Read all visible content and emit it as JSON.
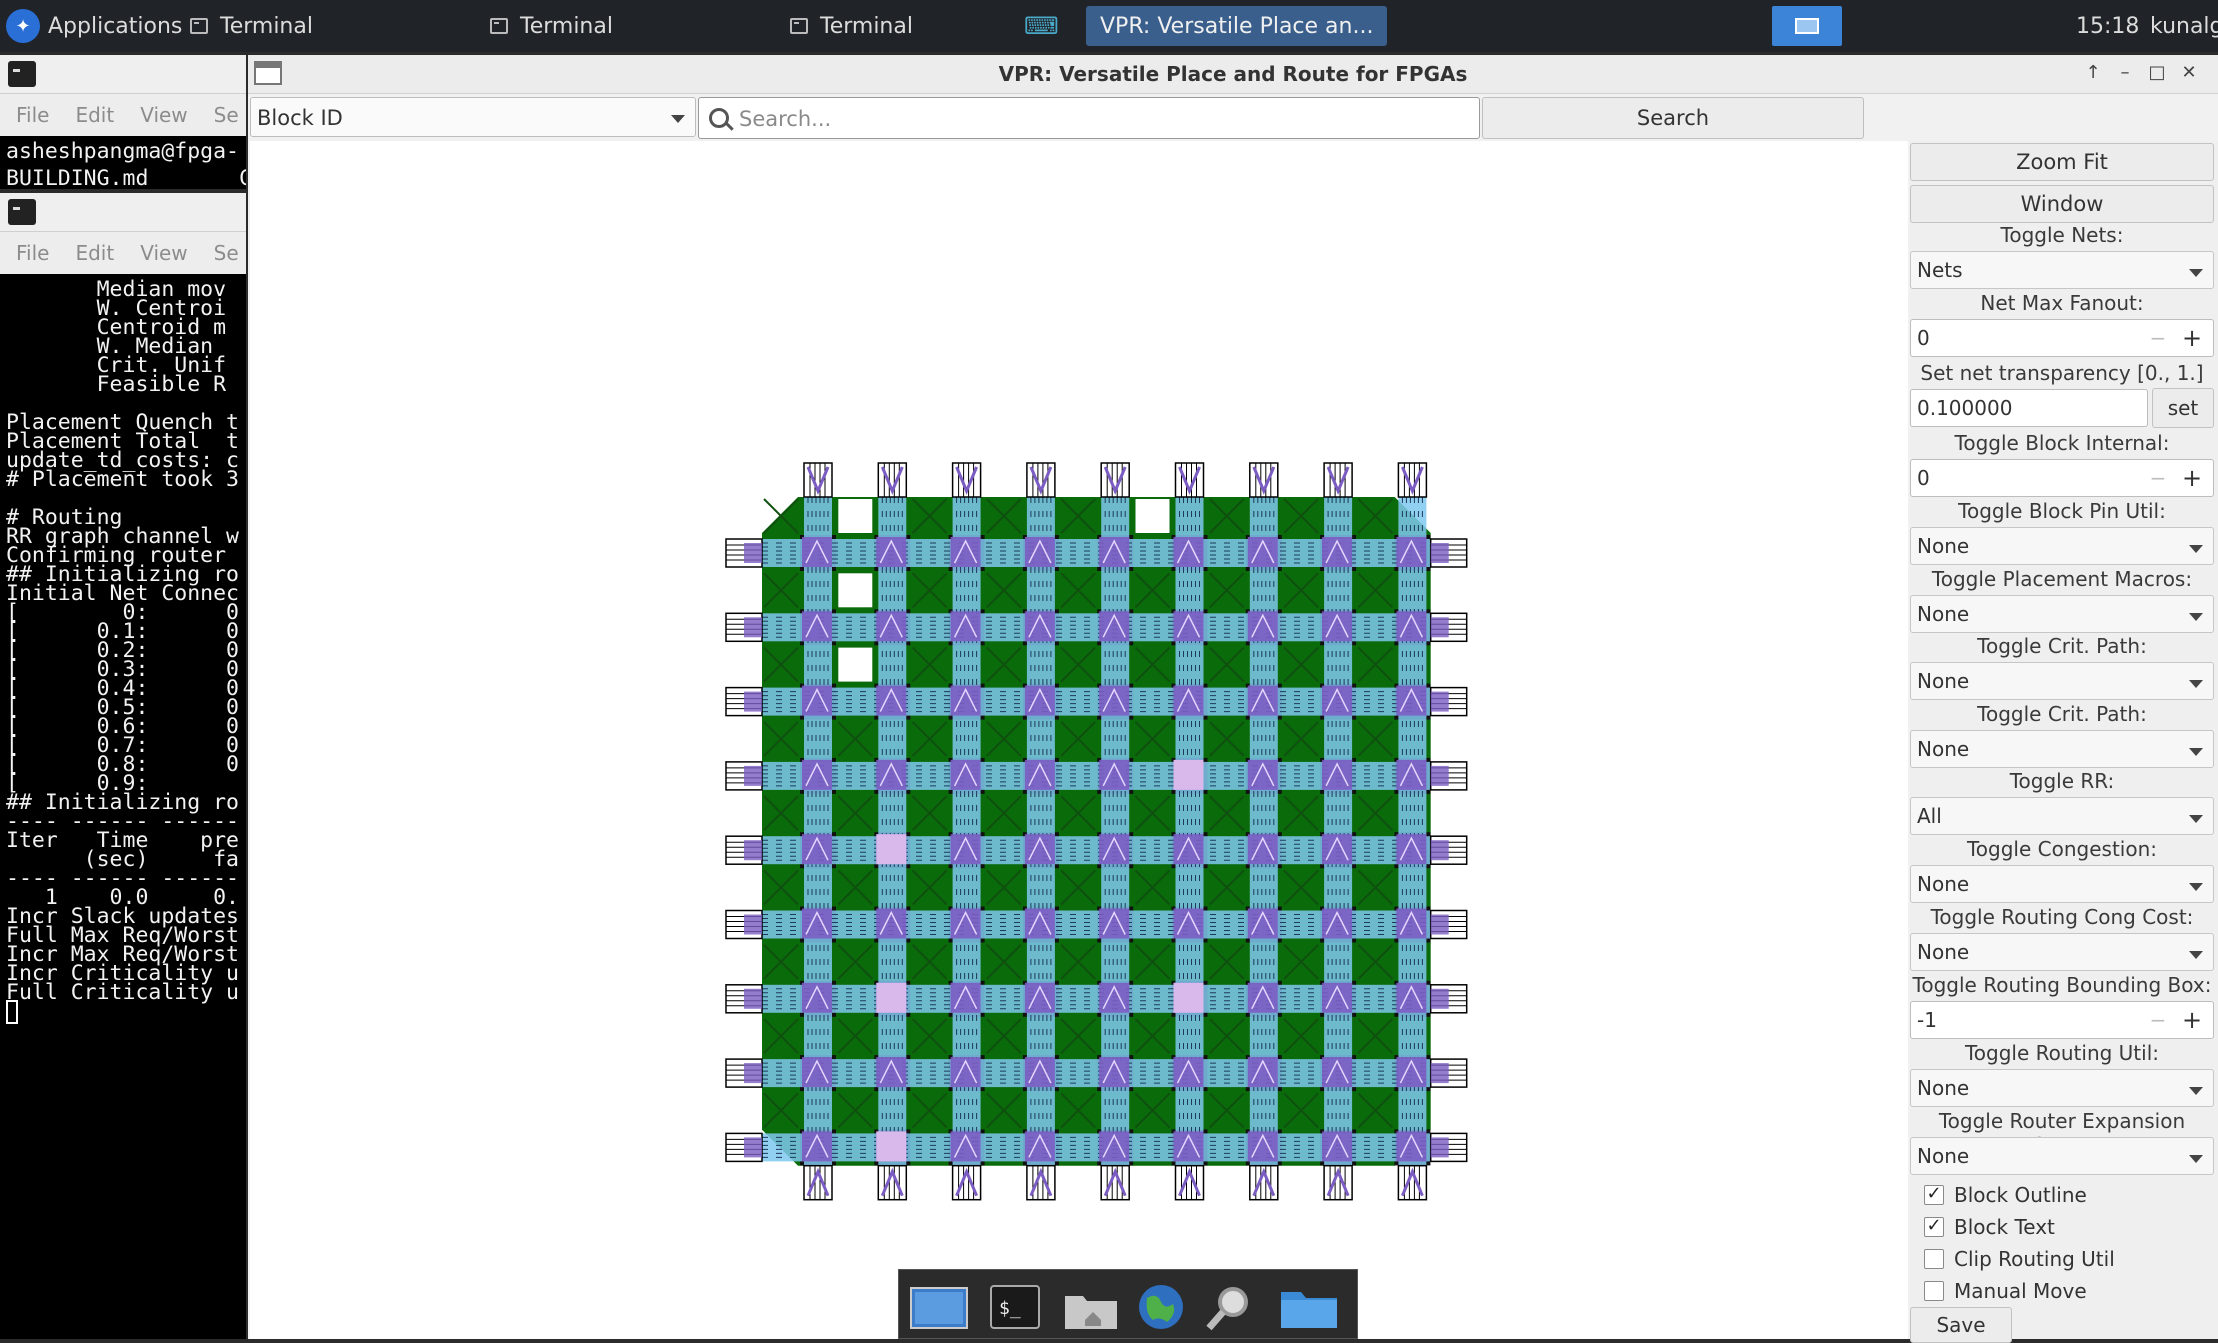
{
  "top_panel": {
    "app_menu": "Applications",
    "tasks": [
      "Terminal",
      "Terminal",
      "Terminal"
    ],
    "active_task": "VPR: Versatile Place an...",
    "clock": "15:18",
    "user": "kunalg"
  },
  "terminal1": {
    "menu": [
      "File",
      "Edit",
      "View",
      "Se"
    ],
    "lines": [
      "asheshpangma@fpga-",
      "BUILDING.md       C"
    ]
  },
  "terminal2": {
    "menu": [
      "File",
      "Edit",
      "View",
      "Se"
    ],
    "lines": [
      "       Median mov",
      "       W. Centroi",
      "       Centroid m",
      "       W. Median ",
      "       Crit. Unif",
      "       Feasible R",
      "",
      "Placement Quench t",
      "Placement Total  t",
      "update_td_costs: c",
      "# Placement took 3",
      "",
      "# Routing",
      "RR graph channel w",
      "Confirming router ",
      "## Initializing ro",
      "Initial Net Connec",
      "[        0:      0",
      "[      0.1:      0",
      "[      0.2:      0",
      "[      0.3:      0",
      "[      0.4:      0",
      "[      0.5:      0",
      "[      0.6:      0",
      "[      0.7:      0",
      "[      0.8:      0",
      "[      0.9:       ",
      "## Initializing ro",
      "---- ------ ------",
      "Iter   Time    pre",
      "      (sec)     fa",
      "---- ------ ------",
      "   1    0.0     0.",
      "Incr Slack updates",
      "Full Max Req/Worst",
      "Incr Max Req/Worst",
      "Incr Criticality u",
      "Full Criticality u"
    ]
  },
  "vpr": {
    "title": "VPR: Versatile Place and Route for FPGAs",
    "window_controls": [
      "↑",
      "–",
      "□",
      "✕"
    ],
    "block_select": "Block ID",
    "search_placeholder": "Search...",
    "search_button": "Search",
    "panel": {
      "zoom_fit": "Zoom Fit",
      "window": "Window",
      "toggle_nets_label": "Toggle Nets:",
      "toggle_nets_value": "Nets",
      "net_max_fanout_label": "Net Max Fanout:",
      "net_max_fanout_value": "0",
      "net_transparency_label": "Set net transparency [0., 1.]",
      "net_transparency_value": "0.100000",
      "net_transparency_set": "set",
      "block_internal_label": "Toggle Block Internal:",
      "block_internal_value": "0",
      "block_pin_util_label": "Toggle Block Pin Util:",
      "block_pin_util_value": "None",
      "placement_macros_label": "Toggle Placement Macros:",
      "placement_macros_value": "None",
      "crit_path_label": "Toggle Crit. Path:",
      "crit_path_value": "None",
      "crit_path2_label": "Toggle Crit. Path:",
      "crit_path2_value": "None",
      "rr_label": "Toggle RR:",
      "rr_value": "All",
      "congestion_label": "Toggle Congestion:",
      "congestion_value": "None",
      "routing_cong_cost_label": "Toggle Routing Cong Cost:",
      "routing_cong_cost_value": "None",
      "routing_bbox_label": "Toggle Routing Bounding Box:",
      "routing_bbox_value": "-1",
      "routing_util_label": "Toggle Routing Util:",
      "routing_util_value": "None",
      "router_expansion_label": "Toggle Router Expansion Costs:",
      "router_expansion_value": "None",
      "checkboxes": [
        {
          "label": "Block Outline",
          "checked": true
        },
        {
          "label": "Block Text",
          "checked": true
        },
        {
          "label": "Clip Routing Util",
          "checked": false
        },
        {
          "label": "Manual Move",
          "checked": false
        }
      ],
      "save": "Save"
    },
    "fpga_grid": {
      "columns": 9,
      "rows": 9,
      "colors": {
        "clb": "#0a6b0a",
        "sb": "#111111",
        "chan": "#7fc8ef",
        "pin": "#7b5cc2",
        "pin_light": "#d9b8ec"
      }
    }
  },
  "dock": {
    "icons": [
      "desktop-icon",
      "terminal-icon",
      "home-folder-icon",
      "browser-icon",
      "search-icon",
      "files-icon"
    ],
    "terminal_glyph": "$_"
  }
}
